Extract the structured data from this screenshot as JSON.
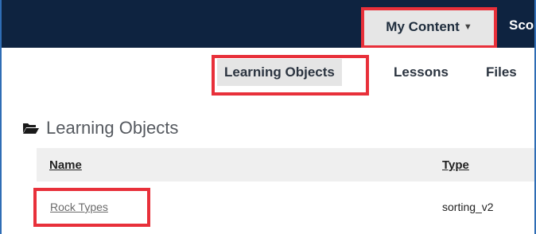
{
  "topbar": {
    "my_content_label": "My Content",
    "caret": "▼",
    "next_item_partial": "Sco"
  },
  "subnav": {
    "tabs": [
      {
        "label": "Learning Objects",
        "active": true
      },
      {
        "label": "Lessons",
        "active": false
      },
      {
        "label": "Files",
        "active": false
      }
    ]
  },
  "section": {
    "title": "Learning Objects",
    "icon": "folder-open-icon"
  },
  "table": {
    "headers": [
      "Name",
      "Type"
    ],
    "rows": [
      {
        "name": "Rock Types",
        "type": "sorting_v2"
      }
    ]
  },
  "colors": {
    "topbar_bg": "#0e2340",
    "highlight_outline": "#e8303a",
    "frame_border": "#2f6db5"
  }
}
